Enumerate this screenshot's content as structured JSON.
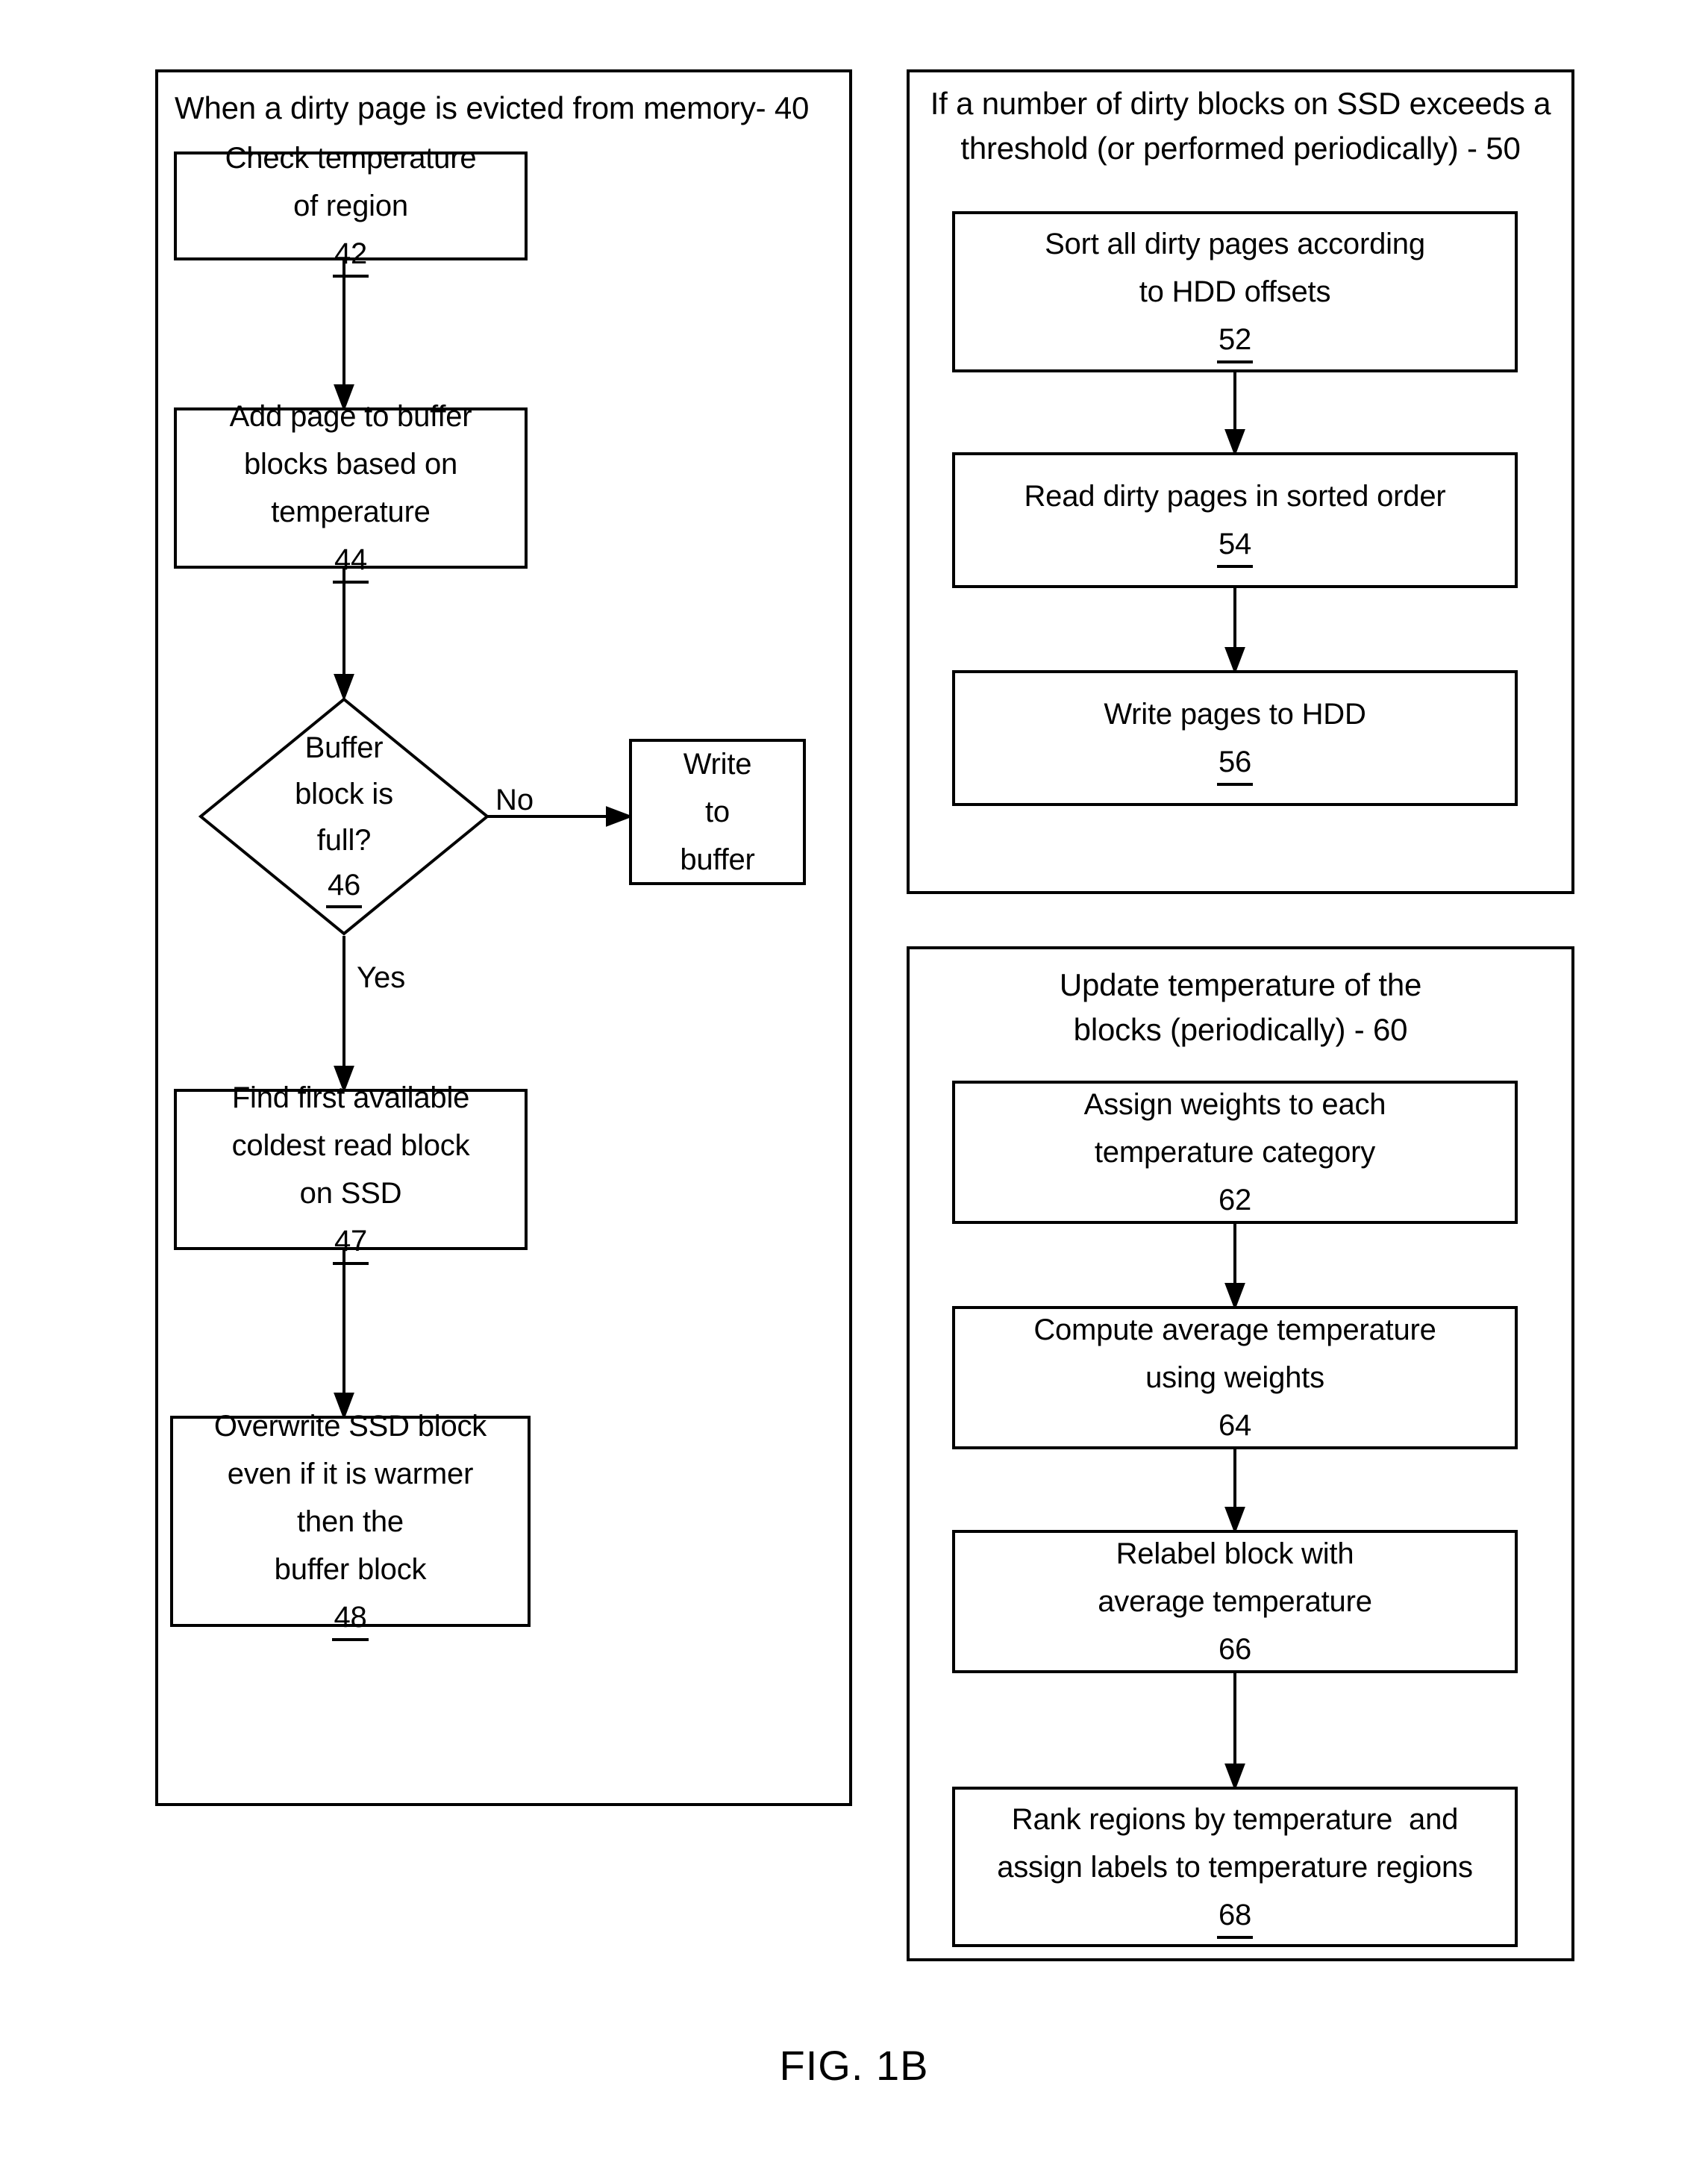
{
  "figure": {
    "caption": "FIG. 1B"
  },
  "panels": [
    {
      "id": "panel-40",
      "title": "When a dirty page is evicted from memory- 40",
      "ref": "40",
      "nodes": [
        {
          "id": "42",
          "lines": [
            "Check temperature",
            "of region"
          ],
          "ref": "42",
          "shape": "process"
        },
        {
          "id": "44",
          "lines": [
            "Add page to buffer",
            "blocks based on",
            "temperature"
          ],
          "ref": "44",
          "shape": "process"
        },
        {
          "id": "46",
          "lines": [
            "Buffer",
            "block is",
            "full?"
          ],
          "ref": "46",
          "shape": "decision"
        },
        {
          "id": "write-to-buffer",
          "lines": [
            "Write",
            "to",
            "buffer"
          ],
          "ref": "",
          "shape": "process"
        },
        {
          "id": "47",
          "lines": [
            "Find first available",
            "coldest read block",
            "on SSD"
          ],
          "ref": "47",
          "shape": "process"
        },
        {
          "id": "48",
          "lines": [
            "Overwrite SSD block",
            "even if it is warmer",
            "then the",
            "buffer block"
          ],
          "ref": "48",
          "shape": "process"
        }
      ],
      "edge_labels": {
        "no": "No",
        "yes": "Yes"
      }
    },
    {
      "id": "panel-50",
      "title_line1": "If a number of dirty blocks on SSD exceeds a",
      "title_line2": "threshold (or performed periodically) - 50",
      "ref": "50",
      "nodes": [
        {
          "id": "52",
          "lines": [
            "Sort all dirty pages according",
            "to HDD offsets"
          ],
          "ref": "52",
          "shape": "process"
        },
        {
          "id": "54",
          "lines": [
            "Read dirty pages in sorted order"
          ],
          "ref": "54",
          "shape": "process"
        },
        {
          "id": "56",
          "lines": [
            "Write pages to HDD"
          ],
          "ref": "56",
          "shape": "process"
        }
      ]
    },
    {
      "id": "panel-60",
      "title_line1": "Update temperature of the",
      "title_line2": "blocks (periodically) - 60",
      "ref": "60",
      "nodes": [
        {
          "id": "62",
          "lines": [
            "Assign weights to each",
            "temperature category"
          ],
          "ref": "62",
          "shape": "process"
        },
        {
          "id": "64",
          "lines": [
            "Compute average temperature",
            "using weights"
          ],
          "ref": "64",
          "shape": "process"
        },
        {
          "id": "66",
          "lines": [
            "Relabel block with",
            "average temperature"
          ],
          "ref": "66",
          "shape": "process"
        },
        {
          "id": "68",
          "lines": [
            "Rank regions by temperature  and",
            "assign labels to temperature regions"
          ],
          "ref": "68",
          "shape": "process"
        }
      ]
    }
  ],
  "text": {
    "p40_title": "When a dirty page is evicted from memory- 40",
    "p50_title_l1": "If a number of dirty blocks on SSD exceeds a",
    "p50_title_l2": "threshold (or performed periodically) - 50",
    "p60_title_l1": "Update temperature of the",
    "p60_title_l2": "blocks (periodically) - 60",
    "n42_l1": "Check temperature",
    "n42_l2": "of region",
    "n42_ref": "42",
    "n44_l1": "Add page to buffer",
    "n44_l2": "blocks based on",
    "n44_l3": "temperature",
    "n44_ref": "44",
    "n46_l1": "Buffer",
    "n46_l2": "block is",
    "n46_l3": "full?",
    "n46_ref": "46",
    "nwb_l1": "Write",
    "nwb_l2": "to",
    "nwb_l3": "buffer",
    "n47_l1": "Find first available",
    "n47_l2": "coldest read block",
    "n47_l3": "on SSD",
    "n47_ref": "47",
    "n48_l1": "Overwrite SSD block",
    "n48_l2": "even if it is warmer",
    "n48_l3": "then the",
    "n48_l4": "buffer block",
    "n48_ref": "48",
    "n52_l1": "Sort all dirty pages according",
    "n52_l2": "to HDD offsets",
    "n52_ref": "52",
    "n54_l1": "Read dirty pages in sorted order",
    "n54_ref": "54",
    "n56_l1": "Write pages to HDD",
    "n56_ref": "56",
    "n62_l1": "Assign weights to each",
    "n62_l2": "temperature category",
    "n62_ref": "62",
    "n64_l1": "Compute average temperature",
    "n64_l2": "using weights",
    "n64_ref": "64",
    "n66_l1": "Relabel block with",
    "n66_l2": "average temperature",
    "n66_ref": "66",
    "n68_l1": "Rank regions by temperature  and",
    "n68_l2": "assign labels to temperature regions",
    "n68_ref": "68",
    "label_no": "No",
    "label_yes": "Yes",
    "caption": "FIG. 1B"
  },
  "colors": {
    "stroke": "#000000",
    "background": "#ffffff"
  }
}
